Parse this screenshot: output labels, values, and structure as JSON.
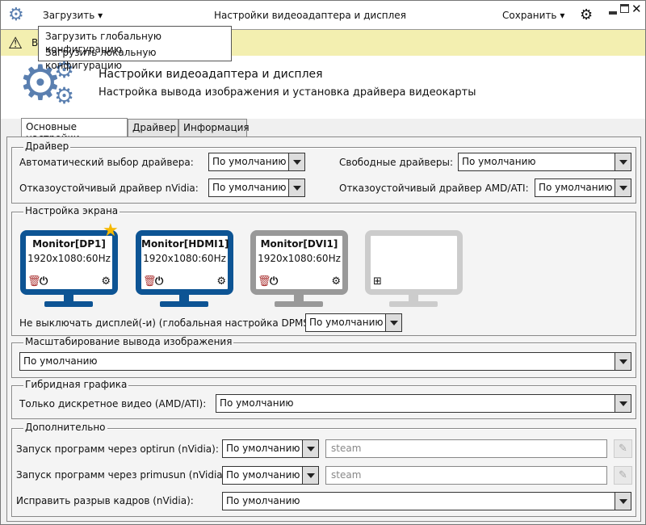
{
  "titlebar": {
    "load_label": "Загрузить",
    "title": "Настройки видеоадаптера и дисплея",
    "save_label": "Сохранить"
  },
  "load_menu": [
    "Загрузить глобальную конфигурацию",
    "Загрузить локальную конфигурацию"
  ],
  "warning": {
    "text": "В"
  },
  "header": {
    "title": "Настройки видеоадаптера и дисплея",
    "subtitle": "Настройка вывода изображения и установка драйвера видеокарты"
  },
  "tabs": [
    "Основные настройки",
    "Драйвер",
    "Информация"
  ],
  "driver": {
    "legend": "Драйвер",
    "auto_label": "Автоматический выбор драйвера:",
    "auto_value": "По умолчанию",
    "free_label": "Свободные драйверы:",
    "free_value": "По умолчанию",
    "nvidia_label": "Отказоустойчивый драйвер nVidia:",
    "nvidia_value": "По умолчанию",
    "amd_label": "Отказоустойчивый драйвер AMD/ATI:",
    "amd_value": "По умолчанию"
  },
  "screen": {
    "legend": "Настройка экрана",
    "monitors": [
      {
        "name": "Monitor[DP1]",
        "res": "1920x1080:60Hz"
      },
      {
        "name": "Monitor[HDMI1]",
        "res": "1920x1080:60Hz"
      },
      {
        "name": "Monitor[DVI1]",
        "res": "1920x1080:60Hz"
      }
    ],
    "dpms_label": "Не выключать дисплей(-и) (глобальная настройка DPMS):",
    "dpms_value": "По умолчанию"
  },
  "scaling": {
    "legend": "Масштабирование вывода изображения",
    "value": "По умолчанию"
  },
  "hybrid": {
    "legend": "Гибридная графика",
    "label": "Только дискретное видео (AMD/ATI):",
    "value": "По умолчанию"
  },
  "extra": {
    "legend": "Дополнительно",
    "optirun_label": "Запуск программ через optirun (nVidia):",
    "optirun_value": "По умолчанию",
    "optirun_placeholder": "steam",
    "primusun_label": "Запуск программ через primusun (nVidia):",
    "primusun_value": "По умолчанию",
    "primusun_placeholder": "steam",
    "tearing_label": "Исправить разрыв кадров (nVidia):",
    "tearing_value": "По умолчанию"
  },
  "colors": {
    "active_monitor": "#0d5494",
    "inactive_monitor": "#999999",
    "empty_monitor": "#cccccc",
    "star": "#f5b800",
    "gear": "#5a7fb0",
    "warning_bg": "#f3efb0"
  }
}
